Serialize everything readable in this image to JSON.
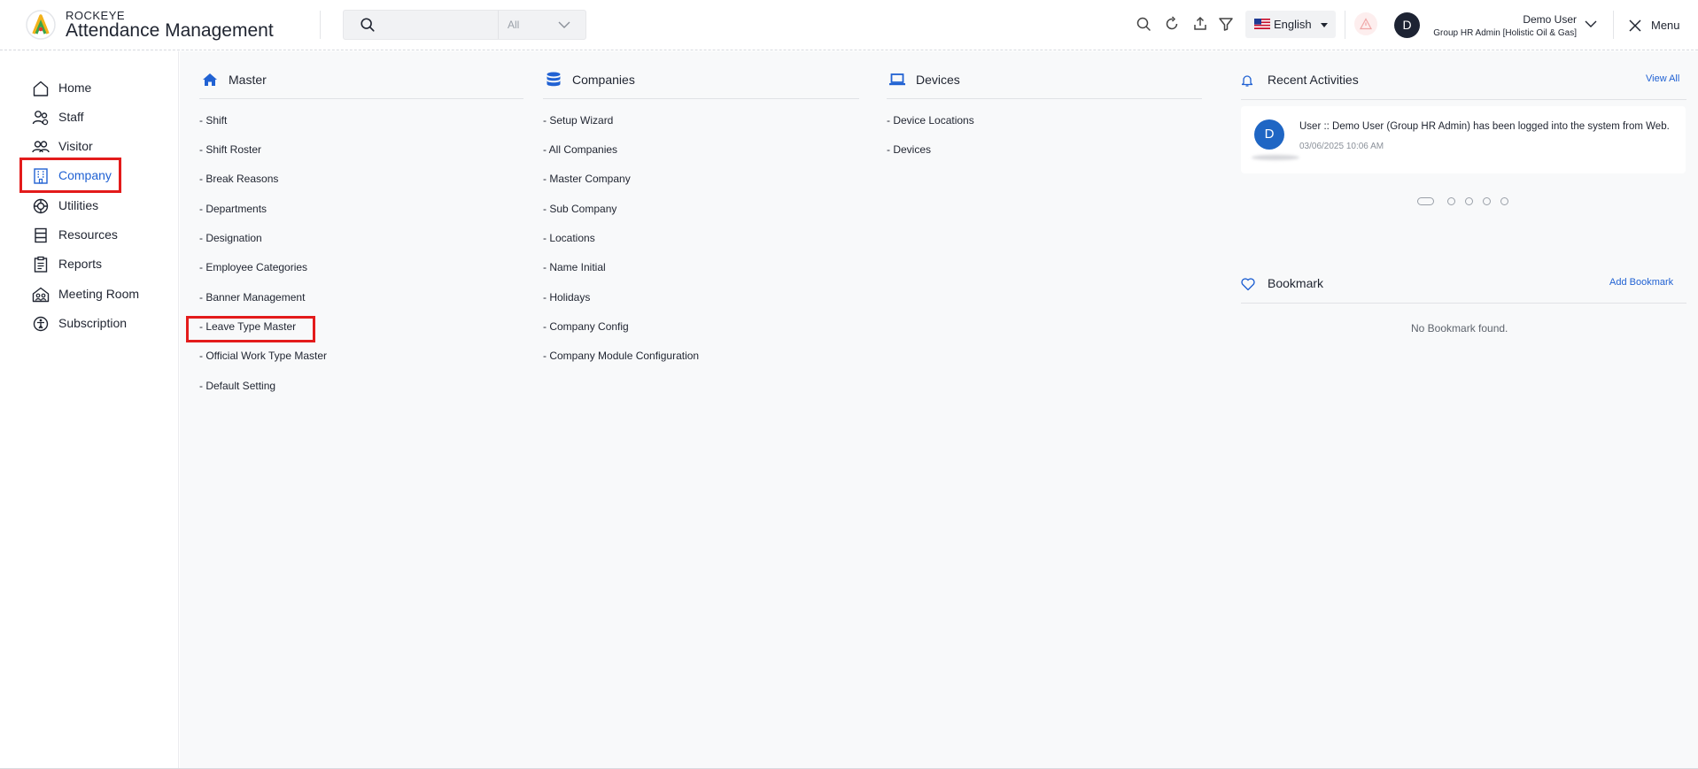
{
  "header": {
    "brand_small": "ROCKEYE",
    "brand_title": "Attendance Management",
    "search": {
      "placeholder": "",
      "select_value": "All"
    },
    "language": "English",
    "user": {
      "avatar_initial": "D",
      "name": "Demo User",
      "role": "Group HR Admin [Holistic Oil & Gas]"
    },
    "menu_label": "Menu",
    "icons": [
      "search-icon",
      "refresh-icon",
      "upload-icon",
      "filter-icon",
      "us-flag-icon",
      "alert-icon",
      "chevron-down-icon",
      "close-icon"
    ]
  },
  "sidebar": {
    "items": [
      {
        "label": "Home",
        "icon": "home-icon"
      },
      {
        "label": "Staff",
        "icon": "staff-icon"
      },
      {
        "label": "Visitor",
        "icon": "visitor-icon"
      },
      {
        "label": "Company",
        "icon": "company-icon",
        "active": true
      },
      {
        "label": "Utilities",
        "icon": "utilities-icon"
      },
      {
        "label": "Resources",
        "icon": "resources-icon"
      },
      {
        "label": "Reports",
        "icon": "reports-icon"
      },
      {
        "label": "Meeting Room",
        "icon": "meeting-room-icon"
      },
      {
        "label": "Subscription",
        "icon": "subscription-icon"
      }
    ]
  },
  "main": {
    "master": {
      "title": "Master",
      "links": [
        "- Shift",
        "- Shift Roster",
        "- Break Reasons",
        "- Departments",
        "- Designation",
        "- Employee Categories",
        "- Banner Management",
        "- Leave Type Master",
        "- Official Work Type Master",
        "- Default Setting"
      ]
    },
    "companies": {
      "title": "Companies",
      "links": [
        "- Setup Wizard",
        "- All Companies",
        "- Master Company",
        "- Sub Company",
        "- Locations",
        "- Name Initial",
        "- Holidays",
        "- Company Config",
        "- Company Module Configuration"
      ]
    },
    "devices": {
      "title": "Devices",
      "links": [
        "- Device Locations",
        "- Devices"
      ]
    },
    "recent_activities": {
      "title": "Recent Activities",
      "view_all": "View All",
      "items": [
        {
          "avatar_initial": "D",
          "text": "User :: Demo User (Group HR Admin) has been logged into the system from Web.",
          "time": "03/06/2025 10:06 AM"
        }
      ],
      "pager_count": 5,
      "pager_active": 0
    },
    "bookmark": {
      "title": "Bookmark",
      "add_label": "Add Bookmark",
      "empty_text": "No Bookmark found."
    }
  },
  "colors": {
    "accent": "#2162d3",
    "highlight": "#e31b1b",
    "avatar_dark": "#1d2333",
    "avatar_blue": "#1f66c4",
    "background": "#f8f9fa"
  }
}
